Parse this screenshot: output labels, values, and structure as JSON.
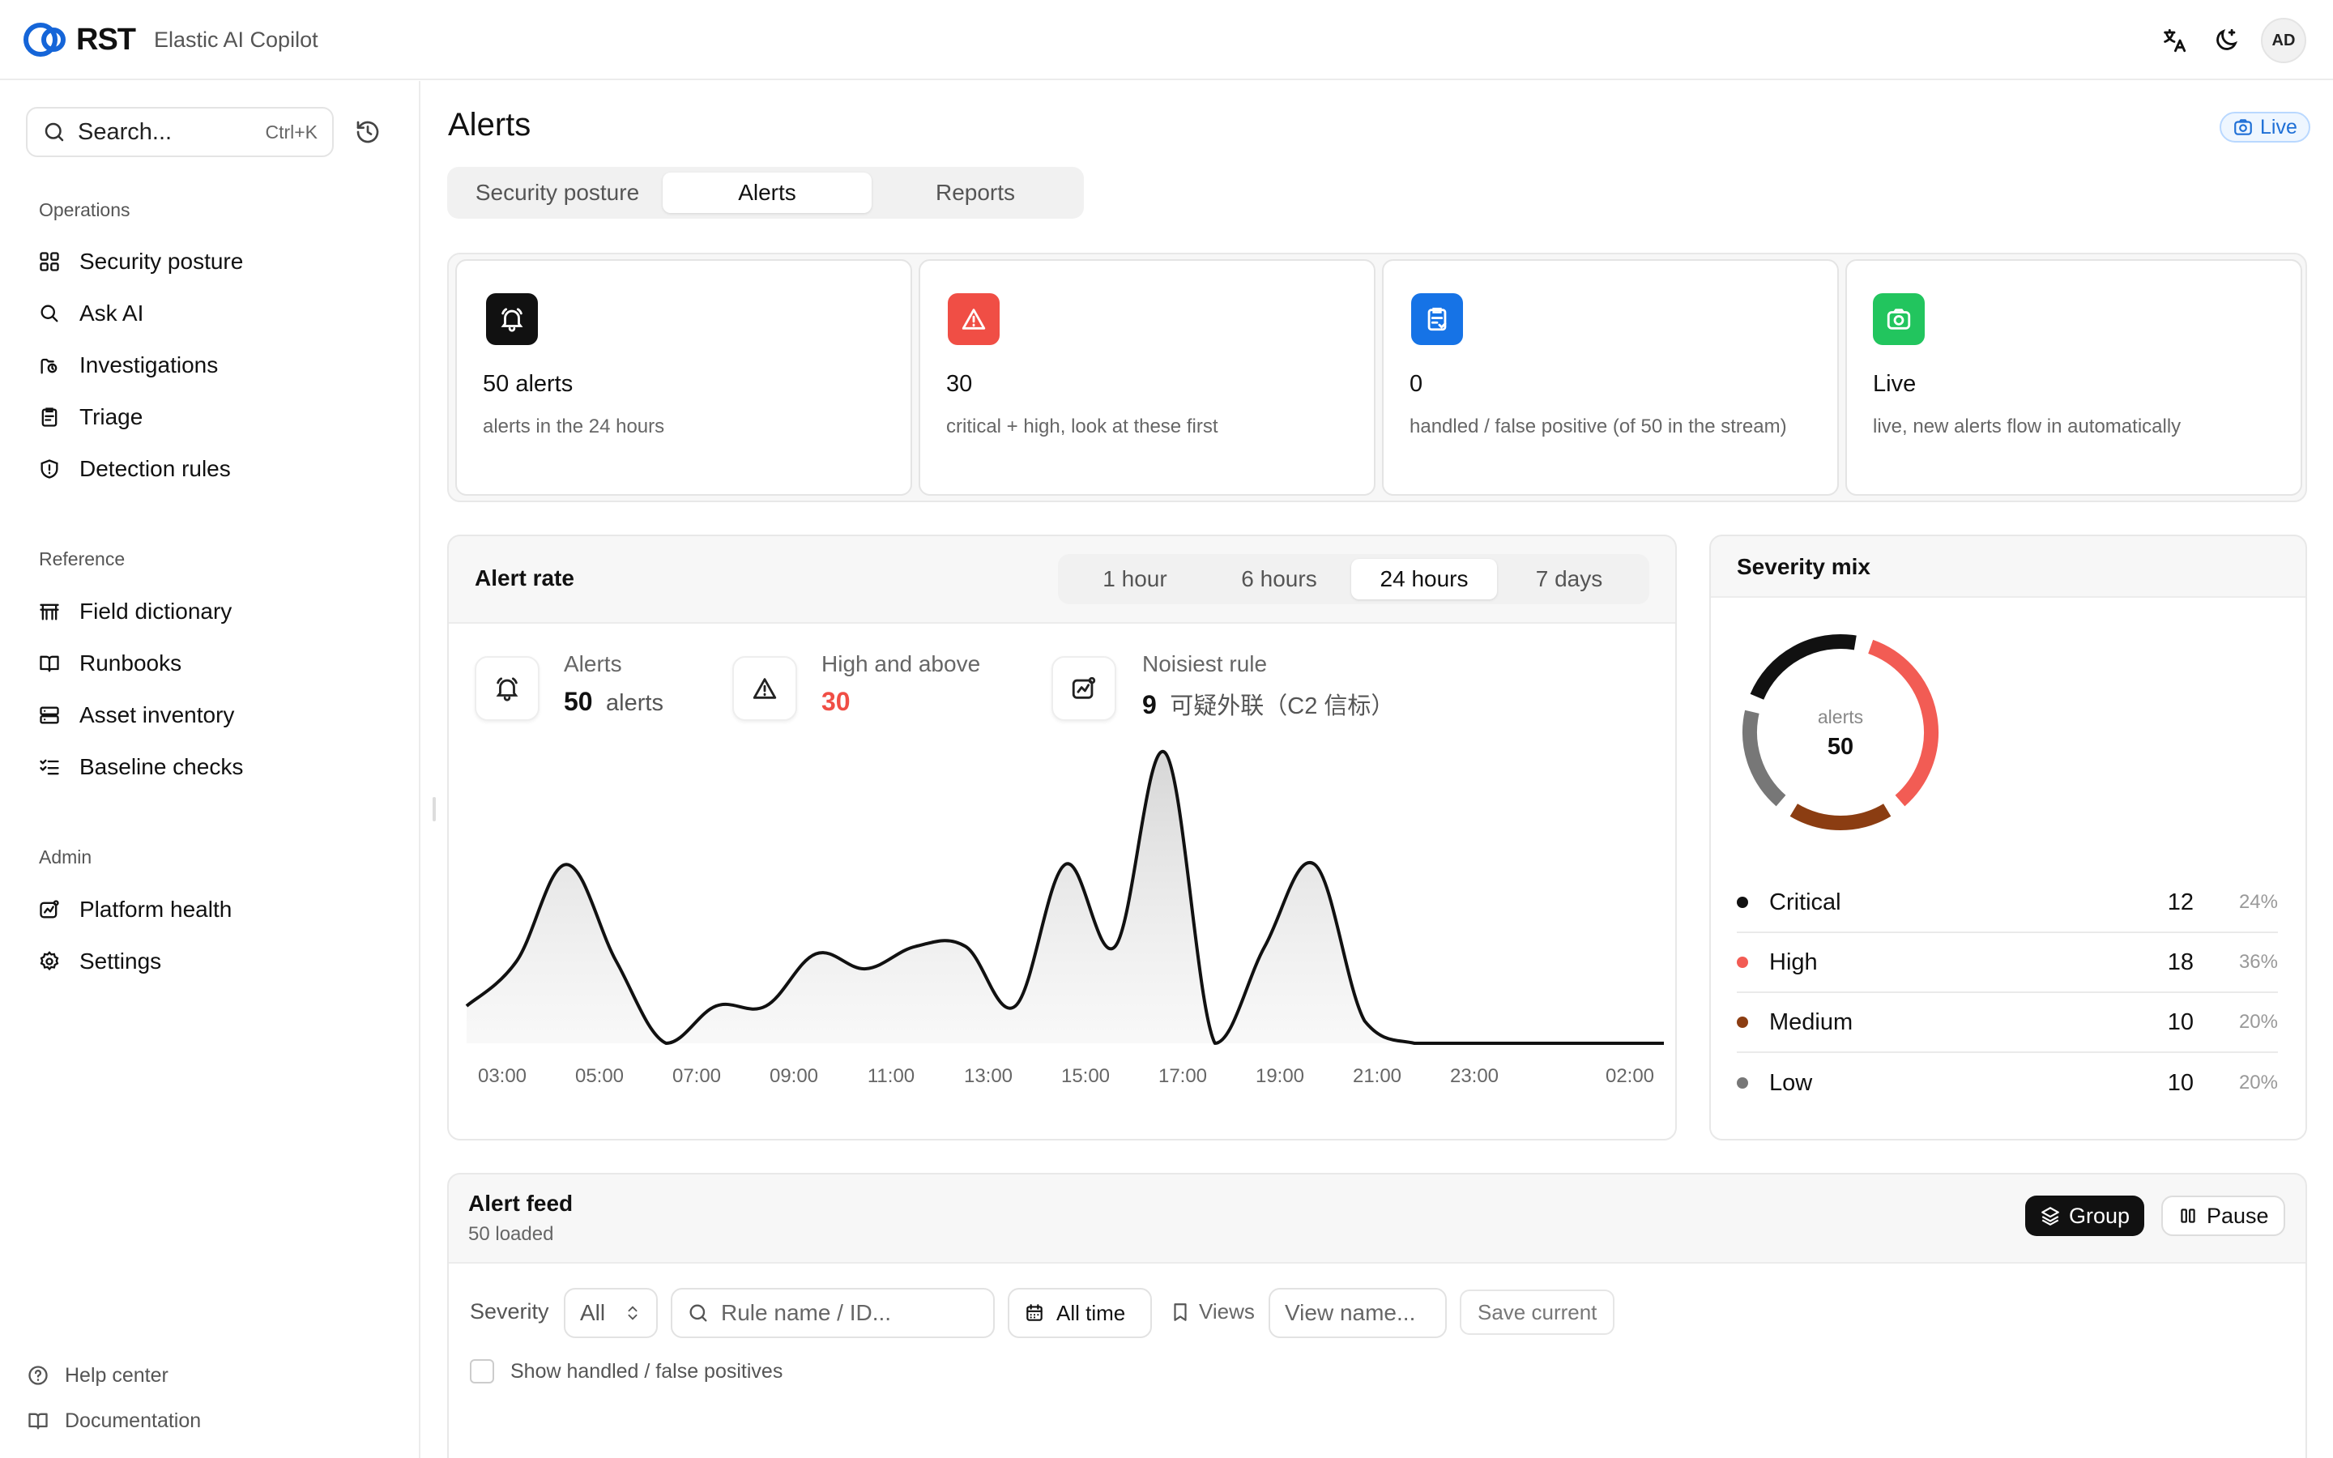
{
  "app": {
    "logo": "RST",
    "subtitle": "Elastic AI Copilot",
    "avatar": "AD"
  },
  "icons": {
    "translate": "translate-icon",
    "theme": "moon-icon",
    "search": "search-icon",
    "history": "history-icon",
    "live": "camera-icon",
    "alerts": "bell-icon",
    "critical": "warning-icon",
    "handled": "clipboard-icon"
  },
  "sidebar": {
    "search_placeholder": "Search...",
    "search_shortcut": "Ctrl+K",
    "sections": [
      {
        "label": "Operations",
        "items": [
          {
            "label": "Security posture",
            "icon": "grid-icon"
          },
          {
            "label": "Ask AI",
            "icon": "search-icon"
          },
          {
            "label": "Investigations",
            "icon": "investigation-icon"
          },
          {
            "label": "Triage",
            "icon": "clipboard-icon"
          },
          {
            "label": "Detection rules",
            "icon": "shield-icon"
          }
        ]
      },
      {
        "label": "Reference",
        "items": [
          {
            "label": "Field dictionary",
            "icon": "table-icon"
          },
          {
            "label": "Runbooks",
            "icon": "book-icon"
          },
          {
            "label": "Asset inventory",
            "icon": "server-icon"
          },
          {
            "label": "Baseline checks",
            "icon": "checklist-icon"
          }
        ]
      },
      {
        "label": "Admin",
        "items": [
          {
            "label": "Platform health",
            "icon": "activity-icon"
          },
          {
            "label": "Settings",
            "icon": "gear-icon"
          }
        ]
      }
    ],
    "footer": [
      {
        "label": "Help center",
        "icon": "help-icon"
      },
      {
        "label": "Documentation",
        "icon": "book-icon"
      }
    ]
  },
  "main": {
    "title": "Alerts",
    "live_label": "Live",
    "tabs": [
      {
        "label": "Security posture",
        "active": false
      },
      {
        "label": "Alerts",
        "active": true
      },
      {
        "label": "Reports",
        "active": false
      }
    ],
    "stats": [
      {
        "title": "50 alerts",
        "desc": "alerts in the 24 hours",
        "icon": "bell-icon",
        "color": "#111111"
      },
      {
        "title": "30",
        "desc": "critical + high, look at these first",
        "icon": "warning-icon",
        "color": "#f04e45"
      },
      {
        "title": "0",
        "desc": "handled / false positive (of 50 in the stream)",
        "icon": "clipboard-icon",
        "color": "#1673e6"
      },
      {
        "title": "Live",
        "desc": "live, new alerts flow in automatically",
        "icon": "camera-icon",
        "color": "#22c55e"
      }
    ],
    "alert_rate": {
      "title": "Alert rate",
      "ranges": [
        {
          "label": "1 hour",
          "active": false
        },
        {
          "label": "6 hours",
          "active": false
        },
        {
          "label": "24 hours",
          "active": true
        },
        {
          "label": "7 days",
          "active": false
        }
      ],
      "kpis": [
        {
          "label": "Alerts",
          "value": "50",
          "unit": "alerts",
          "icon": "bell-icon"
        },
        {
          "label": "High and above",
          "value": "30",
          "unit": "",
          "icon": "warning-icon"
        },
        {
          "label": "Noisiest rule",
          "value": "9",
          "unit": "可疑外联（C2 信标）",
          "icon": "activity-icon"
        }
      ]
    },
    "severity": {
      "title": "Severity mix",
      "center_label": "alerts",
      "center_value": "50",
      "items": [
        {
          "name": "Critical",
          "count": 12,
          "pct": "24%",
          "color": "#111111"
        },
        {
          "name": "High",
          "count": 18,
          "pct": "36%",
          "color": "#f25c54"
        },
        {
          "name": "Medium",
          "count": 10,
          "pct": "20%",
          "color": "#8b3d12"
        },
        {
          "name": "Low",
          "count": 10,
          "pct": "20%",
          "color": "#777777"
        }
      ]
    },
    "feed": {
      "title": "Alert feed",
      "subtitle": "50 loaded",
      "group_label": "Group",
      "pause_label": "Pause",
      "severity_label": "Severity",
      "severity_value": "All",
      "rule_placeholder": "Rule name / ID...",
      "time_label": "All time",
      "views_label": "Views",
      "view_placeholder": "View name...",
      "save_label": "Save current",
      "show_handled": "Show handled / false positives"
    }
  },
  "chart_data": {
    "type": "area",
    "title": "",
    "xlabel": "",
    "ylabel": "",
    "x_ticks": [
      "03:00",
      "05:00",
      "07:00",
      "09:00",
      "11:00",
      "13:00",
      "15:00",
      "17:00",
      "19:00",
      "21:00",
      "23:00",
      "02:00"
    ],
    "x": [
      0,
      1,
      2,
      3,
      4,
      5,
      6,
      7,
      8,
      9,
      10,
      11,
      12,
      13,
      14,
      15,
      16,
      17,
      18,
      19,
      20,
      21,
      22,
      23,
      24
    ],
    "values": [
      1,
      2.2,
      4.8,
      2.2,
      0,
      1,
      1,
      2.4,
      2,
      2.6,
      2.6,
      1,
      4.8,
      2.6,
      7.8,
      0,
      2.6,
      4.8,
      0.6,
      0,
      0,
      0,
      0,
      0,
      0
    ],
    "ylim": [
      0,
      8
    ],
    "grid": false,
    "legend": "none"
  }
}
